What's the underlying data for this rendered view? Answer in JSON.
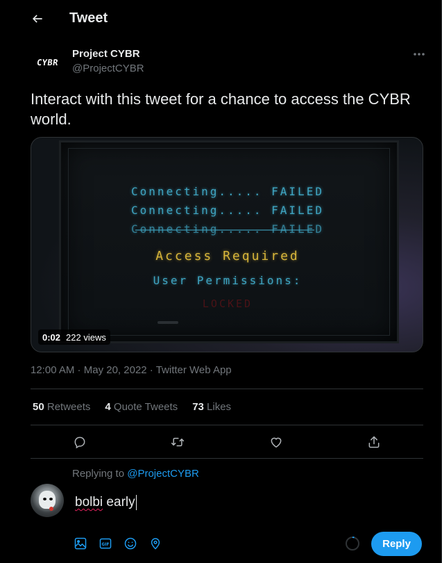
{
  "header": {
    "title": "Tweet",
    "back_icon": "arrow-left-icon"
  },
  "author": {
    "avatar_text": "CYBR",
    "name": "Project CYBR",
    "handle": "@ProjectCYBR"
  },
  "tweet": {
    "text": "Interact with this tweet for a chance to access the CYBR world.",
    "media": {
      "screen_lines": {
        "line1": "Connecting..... FAILED",
        "line2": "Connecting..... FAILED",
        "line3": "Connecting..... FAILED",
        "access": "Access Required",
        "permissions": "User Permissions:",
        "locked": "LOCKED"
      },
      "duration": "0:02",
      "views": "222 views"
    },
    "time": "12:00 AM",
    "date": "May 20, 2022",
    "source": "Twitter Web App",
    "separator": " · "
  },
  "stats": {
    "retweets_count": "50",
    "retweets_label": " Retweets",
    "quotes_count": "4",
    "quotes_label": " Quote Tweets",
    "likes_count": "73",
    "likes_label": " Likes"
  },
  "reply": {
    "replying_prefix": "Replying to ",
    "replying_to": "@ProjectCYBR",
    "text_word1": "bolbi",
    "text_word2": " early",
    "button_label": "Reply"
  },
  "colors": {
    "accent": "#1d9bf0",
    "background": "#000000",
    "muted": "#71767b",
    "terminal_cyan": "#3fa5c2",
    "terminal_gold": "#d7b53a"
  }
}
